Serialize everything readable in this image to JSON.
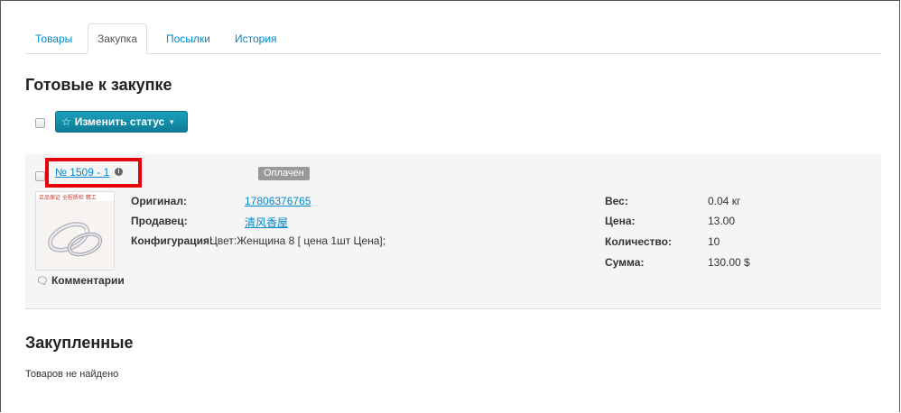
{
  "tabs": [
    {
      "label": "Товары",
      "active": false
    },
    {
      "label": "Закупка",
      "active": true
    },
    {
      "label": "Посылки",
      "active": false
    },
    {
      "label": "История",
      "active": false
    }
  ],
  "ready_section": {
    "title": "Готовые к закупке",
    "status_button": {
      "label": "Изменить статус",
      "icon": "star-icon"
    }
  },
  "order": {
    "number": "№ 1509 - 1",
    "status_badge": "Оплачен",
    "original_label": "Оригинал:",
    "original_value": "17806376765",
    "seller_label": "Продавец:",
    "seller_value": "清风香屋",
    "config_label": "Конфигурация:",
    "config_value": "Цвет:Женщина 8 [ цена 1шт Цена];",
    "weight_label": "Вес:",
    "weight_value": "0.04 кг",
    "price_label": "Цена:",
    "price_value": "13.00",
    "qty_label": "Количество:",
    "qty_value": "10",
    "sum_label": "Сумма:",
    "sum_value": "130.00 $",
    "comments_label": "Комментарии",
    "thumb_caption": "正品保证 全程质检 精工"
  },
  "bought_section": {
    "title": "Закупленные",
    "empty_text": "Товаров не найдено"
  },
  "colors": {
    "link": "#0088cc",
    "status_button": "#1596b2",
    "badge": "#999999",
    "highlight": "#e5000a"
  }
}
